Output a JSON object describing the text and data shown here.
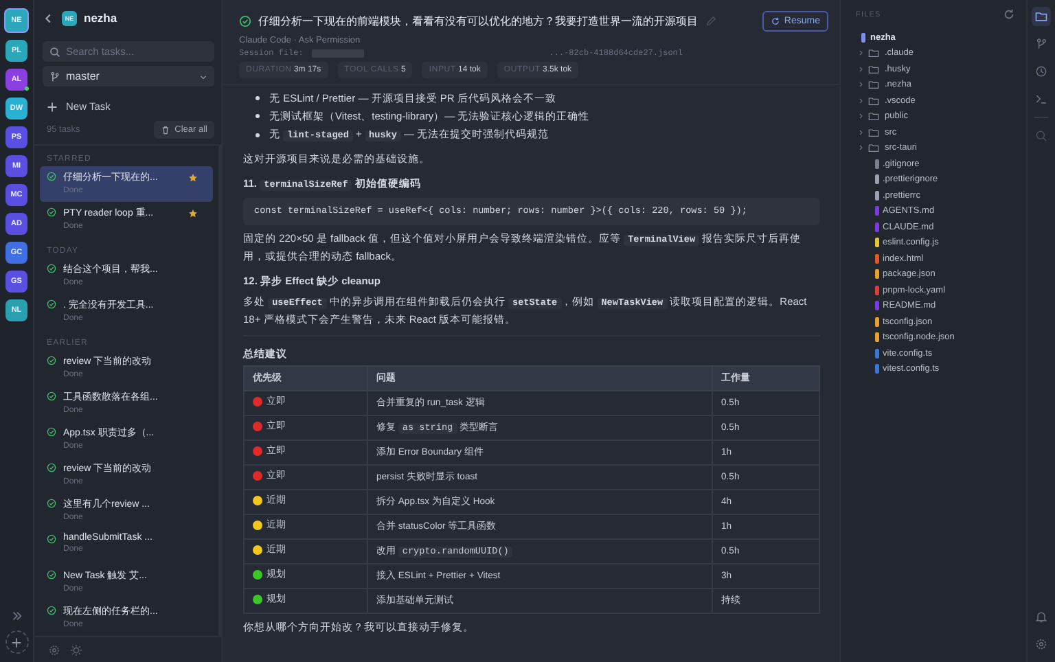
{
  "workspaces": [
    {
      "initials": "NE",
      "color": "#2aa7b8",
      "selected": true,
      "online": false
    },
    {
      "initials": "PL",
      "color": "#2aa7b8",
      "selected": false,
      "online": false
    },
    {
      "initials": "AL",
      "color": "#8a3fe0",
      "selected": false,
      "online": true
    },
    {
      "initials": "DW",
      "color": "#2ab0d0",
      "selected": false,
      "online": false
    },
    {
      "initials": "PS",
      "color": "#5a4fe0",
      "selected": false,
      "online": false
    },
    {
      "initials": "MI",
      "color": "#5a4fe0",
      "selected": false,
      "online": false
    },
    {
      "initials": "MC",
      "color": "#5a4fe0",
      "selected": false,
      "online": false
    },
    {
      "initials": "AD",
      "color": "#5a4fe0",
      "selected": false,
      "online": false
    },
    {
      "initials": "GC",
      "color": "#3f6fe0",
      "selected": false,
      "online": false
    },
    {
      "initials": "GS",
      "color": "#5a4fe0",
      "selected": false,
      "online": false
    },
    {
      "initials": "NL",
      "color": "#2a9fb0",
      "selected": false,
      "online": false
    }
  ],
  "sidebar": {
    "project_initials": "NE",
    "project": "nezha",
    "search": {
      "placeholder": "Search tasks..."
    },
    "branch": "master",
    "new_task": "New Task",
    "task_count": "95 tasks",
    "clear_all": "Clear all",
    "groups": [
      {
        "label": "STARRED",
        "tasks": [
          {
            "title": "仔细分析一下现在的...",
            "status": "Done",
            "starred": true,
            "selected": true
          },
          {
            "title": "PTY reader loop 重...",
            "status": "Done",
            "starred": true,
            "selected": false
          }
        ]
      },
      {
        "label": "TODAY",
        "tasks": [
          {
            "title": "结合这个项目，帮我...",
            "status": "Done",
            "starred": false,
            "selected": false
          },
          {
            "title": ". 完全没有开发工具...",
            "status": "Done",
            "starred": false,
            "selected": false
          }
        ]
      },
      {
        "label": "EARLIER",
        "tasks": [
          {
            "title": "review 下当前的改动",
            "status": "Done",
            "starred": false,
            "selected": false
          },
          {
            "title": "工具函数散落在各组...",
            "status": "Done",
            "starred": false,
            "selected": false
          },
          {
            "title": "App.tsx 职责过多（...",
            "status": "Done",
            "starred": false,
            "selected": false
          },
          {
            "title": "review 下当前的改动",
            "status": "Done",
            "starred": false,
            "selected": false
          },
          {
            "title": "这里有几个review ...",
            "status": "Done",
            "starred": false,
            "selected": false
          },
          {
            "title": "handleSubmitTask ...",
            "status": "Done",
            "starred": false,
            "selected": false
          },
          {
            "title": "New Task 触发 艾...",
            "status": "Done",
            "starred": false,
            "selected": false
          },
          {
            "title": "现在左侧的任务栏的...",
            "status": "Done",
            "starred": false,
            "selected": false
          }
        ]
      }
    ]
  },
  "task": {
    "title": "仔细分析一下现在的前端模块，看看有没有可以优化的地方？我要打造世界一流的开源项目",
    "resume": "Resume",
    "agent": "Claude Code · Ask Permission",
    "session_label": "Session file:",
    "session_file": "...-82cb-4188d64cde27.jsonl",
    "stats": [
      {
        "label": "DURATION",
        "value": "3m 17s"
      },
      {
        "label": "TOOL CALLS",
        "value": "5"
      },
      {
        "label": "INPUT",
        "value": "14 tok"
      },
      {
        "label": "OUTPUT",
        "value": "3.5k tok"
      }
    ]
  },
  "content": [
    {
      "kind": "bullet",
      "parts": [
        {
          "kind": "text",
          "text": "无 ESLint / Prettier — 开源项目接受 PR 后代码风格会不一致"
        }
      ]
    },
    {
      "kind": "bullet",
      "parts": [
        {
          "kind": "text",
          "text": "无测试框架（Vitest、testing-library）— 无法验证核心逻辑的正确性"
        }
      ]
    },
    {
      "kind": "bullet",
      "parts": [
        {
          "kind": "text",
          "text": "无 "
        },
        {
          "kind": "code",
          "text": "lint-staged"
        },
        {
          "kind": "text",
          "text": " + "
        },
        {
          "kind": "code",
          "text": "husky"
        },
        {
          "kind": "text",
          "text": " — 无法在提交时强制代码规范"
        }
      ]
    },
    {
      "kind": "para",
      "parts": [
        {
          "kind": "text",
          "text": "这对开源项目来说是必需的基础设施。"
        }
      ]
    },
    {
      "kind": "heading",
      "parts": [
        {
          "kind": "text",
          "text": "11. "
        },
        {
          "kind": "code",
          "text": "terminalSizeRef"
        },
        {
          "kind": "text",
          "text": " 初始值硬编码"
        }
      ]
    },
    {
      "kind": "codeblock",
      "code": "const terminalSizeRef = useRef<{ cols: number; rows: number }>({ cols: 220, rows: 50 });"
    },
    {
      "kind": "para",
      "parts": [
        {
          "kind": "text",
          "text": "固定的 220×50 是 fallback 值，但这个值对小屏用户会导致终端渲染错位。应等 "
        },
        {
          "kind": "code",
          "text": "TerminalView"
        },
        {
          "kind": "text",
          "text": " 报告实际尺寸后再使用，或提供合理的动态 fallback。"
        }
      ]
    },
    {
      "kind": "heading",
      "parts": [
        {
          "kind": "text",
          "text": "12. 异步 Effect 缺少 cleanup"
        }
      ]
    },
    {
      "kind": "para",
      "parts": [
        {
          "kind": "text",
          "text": "多处 "
        },
        {
          "kind": "code",
          "text": "useEffect"
        },
        {
          "kind": "text",
          "text": " 中的异步调用在组件卸载后仍会执行 "
        },
        {
          "kind": "code",
          "text": "setState"
        },
        {
          "kind": "text",
          "text": "，例如 "
        },
        {
          "kind": "code",
          "text": "NewTaskView"
        },
        {
          "kind": "text",
          "text": " 读取项目配置的逻辑。React 18+ 严格模式下会产生警告，未来 React 版本可能报错。"
        }
      ]
    },
    {
      "kind": "rule"
    },
    {
      "kind": "heading",
      "parts": [
        {
          "kind": "text",
          "text": "总结建议"
        }
      ]
    }
  ],
  "summary_table": {
    "columns": [
      "优先级",
      "问题",
      "工作量"
    ],
    "rows": [
      {
        "color": "#e02a2a",
        "priority": "立即",
        "issue": [
          {
            "kind": "text",
            "text": "合并重复的 run_task 逻辑"
          }
        ],
        "effort": "0.5h"
      },
      {
        "color": "#e02a2a",
        "priority": "立即",
        "issue": [
          {
            "kind": "text",
            "text": "修复 "
          },
          {
            "kind": "code",
            "text": "as string"
          },
          {
            "kind": "text",
            "text": " 类型断言"
          }
        ],
        "effort": "0.5h"
      },
      {
        "color": "#e02a2a",
        "priority": "立即",
        "issue": [
          {
            "kind": "text",
            "text": "添加 Error Boundary 组件"
          }
        ],
        "effort": "1h"
      },
      {
        "color": "#e02a2a",
        "priority": "立即",
        "issue": [
          {
            "kind": "text",
            "text": "persist 失败时显示 toast"
          }
        ],
        "effort": "0.5h"
      },
      {
        "color": "#f2c81e",
        "priority": "近期",
        "issue": [
          {
            "kind": "text",
            "text": "拆分 App.tsx 为自定义 Hook"
          }
        ],
        "effort": "4h"
      },
      {
        "color": "#f2c81e",
        "priority": "近期",
        "issue": [
          {
            "kind": "text",
            "text": "合并 statusColor 等工具函数"
          }
        ],
        "effort": "1h"
      },
      {
        "color": "#f2c81e",
        "priority": "近期",
        "issue": [
          {
            "kind": "text",
            "text": "改用 "
          },
          {
            "kind": "code",
            "text": "crypto.randomUUID()"
          }
        ],
        "effort": "0.5h"
      },
      {
        "color": "#3cc62a",
        "priority": "规划",
        "issue": [
          {
            "kind": "text",
            "text": "接入 ESLint + Prettier + Vitest"
          }
        ],
        "effort": "3h"
      },
      {
        "color": "#3cc62a",
        "priority": "规划",
        "issue": [
          {
            "kind": "text",
            "text": "添加基础单元测试"
          }
        ],
        "effort": "持续"
      }
    ]
  },
  "closing": "你想从哪个方向开始改？我可以直接动手修复。",
  "files": {
    "title": "FILES",
    "root": "nezha",
    "items": [
      {
        "kind": "folder",
        "name": ".claude",
        "expanded": false
      },
      {
        "kind": "folder",
        "name": ".husky",
        "expanded": false
      },
      {
        "kind": "folder",
        "name": ".nezha",
        "expanded": false
      },
      {
        "kind": "folder",
        "name": ".vscode",
        "expanded": false
      },
      {
        "kind": "folder",
        "name": "public",
        "expanded": false
      },
      {
        "kind": "folder",
        "name": "src",
        "expanded": false
      },
      {
        "kind": "folder",
        "name": "src-tauri",
        "expanded": false
      },
      {
        "kind": "file",
        "name": ".gitignore",
        "color": "#7c8190"
      },
      {
        "kind": "file",
        "name": ".prettierignore",
        "color": "#9aa0b0"
      },
      {
        "kind": "file",
        "name": ".prettierrc",
        "color": "#9aa0b0"
      },
      {
        "kind": "file",
        "name": "AGENTS.md",
        "color": "#7c3ae0"
      },
      {
        "kind": "file",
        "name": "CLAUDE.md",
        "color": "#7c3ae0"
      },
      {
        "kind": "file",
        "name": "eslint.config.js",
        "color": "#e8c040"
      },
      {
        "kind": "file",
        "name": "index.html",
        "color": "#e0582a"
      },
      {
        "kind": "file",
        "name": "package.json",
        "color": "#e8a030"
      },
      {
        "kind": "file",
        "name": "pnpm-lock.yaml",
        "color": "#d84040"
      },
      {
        "kind": "file",
        "name": "README.md",
        "color": "#7c3ae0"
      },
      {
        "kind": "file",
        "name": "tsconfig.json",
        "color": "#e8a030"
      },
      {
        "kind": "file",
        "name": "tsconfig.node.json",
        "color": "#e8a030"
      },
      {
        "kind": "file",
        "name": "vite.config.ts",
        "color": "#3a78d8"
      },
      {
        "kind": "file",
        "name": "vitest.config.ts",
        "color": "#3a78d8"
      }
    ]
  }
}
